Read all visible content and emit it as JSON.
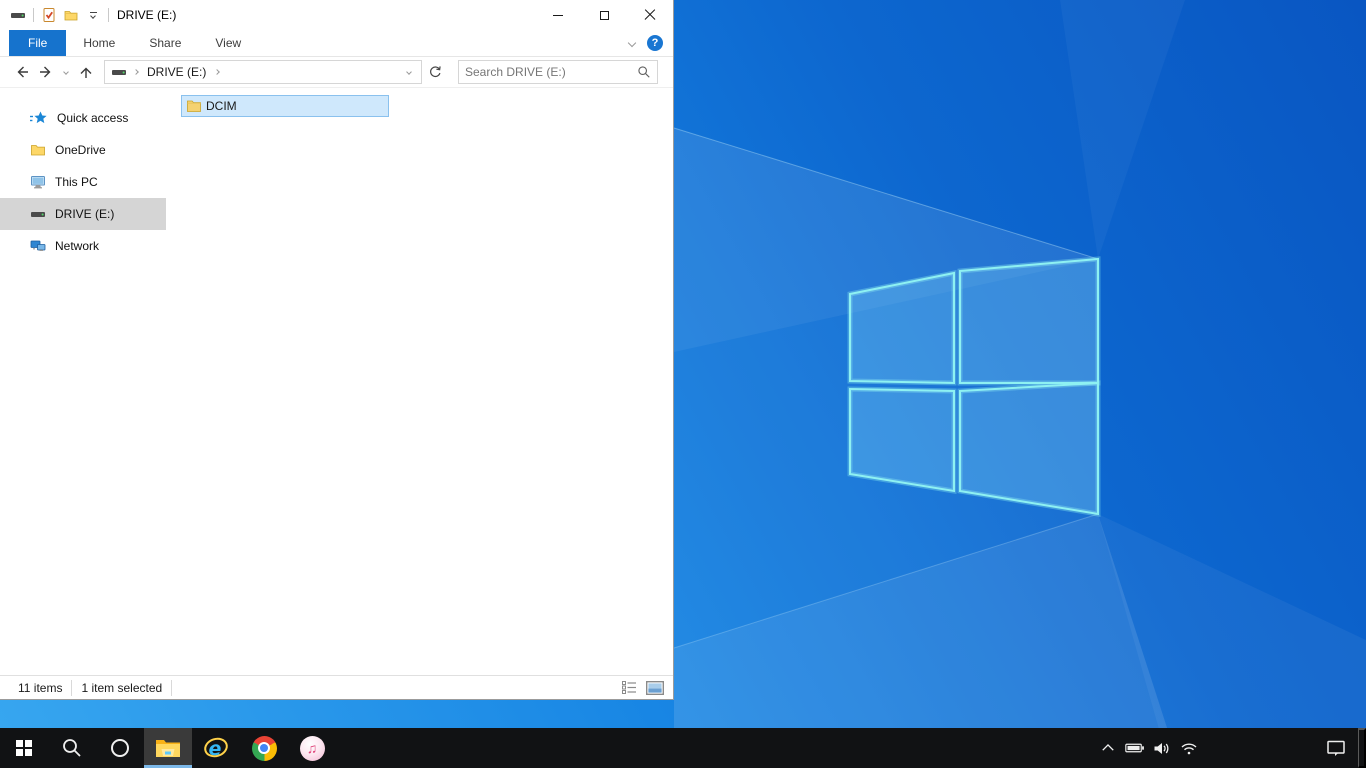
{
  "window": {
    "title": "DRIVE (E:)",
    "tabs": [
      {
        "label": "File",
        "active": true
      },
      {
        "label": "Home",
        "active": false
      },
      {
        "label": "Share",
        "active": false
      },
      {
        "label": "View",
        "active": false
      }
    ],
    "help_glyph": "?",
    "navigation": {
      "address_segment": "DRIVE (E:)",
      "search_placeholder": "Search DRIVE (E:)"
    },
    "sidebar": {
      "items": [
        {
          "label": "Quick access",
          "icon": "quick-access-star-icon",
          "selected": false
        },
        {
          "label": "OneDrive",
          "icon": "onedrive-folder-icon",
          "selected": false
        },
        {
          "label": "This PC",
          "icon": "this-pc-icon",
          "selected": false
        },
        {
          "label": "DRIVE (E:)",
          "icon": "drive-icon",
          "selected": true
        },
        {
          "label": "Network",
          "icon": "network-icon",
          "selected": false
        }
      ]
    },
    "files": [
      {
        "name": "DCIM",
        "icon": "folder-icon",
        "selected": true
      }
    ],
    "status": {
      "items_text": "11 items",
      "selection_text": "1 item selected"
    }
  },
  "taskbar": {
    "buttons": [
      {
        "name": "start",
        "icon": "windows-logo-icon"
      },
      {
        "name": "search",
        "icon": "search-icon"
      },
      {
        "name": "cortana",
        "icon": "cortana-icon"
      },
      {
        "name": "file-explorer",
        "icon": "file-explorer-icon",
        "active": true
      },
      {
        "name": "internet-explorer",
        "icon": "internet-explorer-icon"
      },
      {
        "name": "chrome",
        "icon": "chrome-icon"
      },
      {
        "name": "itunes",
        "icon": "itunes-icon"
      }
    ],
    "tray_icons": [
      "hidden-icons-chevron",
      "battery-icon",
      "volume-icon",
      "wifi-icon"
    ],
    "action_center_icon": "action-center-icon"
  },
  "icons": {
    "ie_letter": "e",
    "itunes_note": "♫"
  },
  "colors": {
    "accent_blue": "#1673cd",
    "selection_fill": "#cfe8fc",
    "selection_border": "#8ac1ee",
    "taskbar_bg": "#111214",
    "active_underline": "#7cb8e8",
    "wallpaper_left": "#38a7f0",
    "wallpaper_right": "#0956c2",
    "logo_edge": "#8ef1f2"
  }
}
